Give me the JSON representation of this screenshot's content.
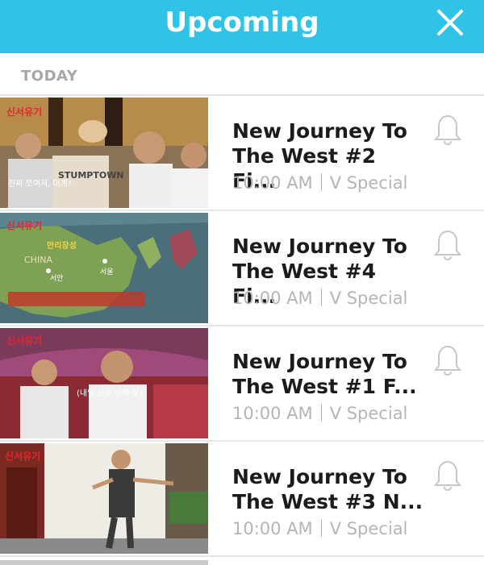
{
  "header": {
    "title": "Upcoming",
    "close_icon": "close-icon",
    "background_color": "#2fc3e8"
  },
  "section": {
    "label": "TODAY"
  },
  "episodes": [
    {
      "title_line1": "New Journey To",
      "title_line2": "The West #2 Fi...",
      "time": "10:00 AM",
      "channel": "V Special",
      "bell_icon": "bell-icon",
      "thumb_caption": "진짜 쪼여져, 이게?",
      "thumb_logo": "신서유기",
      "thumb_cap_text": "STUMPTOWN"
    },
    {
      "title_line1": "New Journey To",
      "title_line2": "The West #4 Fi...",
      "time": "10:00 AM",
      "channel": "V Special",
      "bell_icon": "bell-icon",
      "thumb_logo": "신서유기",
      "thumb_map_label": "CHINA",
      "thumb_map_city1": "서안",
      "thumb_map_city2": "서울",
      "thumb_map_banner": "만리장성"
    },
    {
      "title_line1": "New Journey To",
      "title_line2": "The West #1 F...",
      "time": "10:00 AM",
      "channel": "V Special",
      "bell_icon": "bell-icon",
      "thumb_logo": "신서유기",
      "thumb_caption": "(내일 오래 안뻑 살)"
    },
    {
      "title_line1": "New Journey To",
      "title_line2": "The West #3 N...",
      "time": "10:00 AM",
      "channel": "V Special",
      "bell_icon": "bell-icon",
      "thumb_logo": "신서유기"
    }
  ]
}
